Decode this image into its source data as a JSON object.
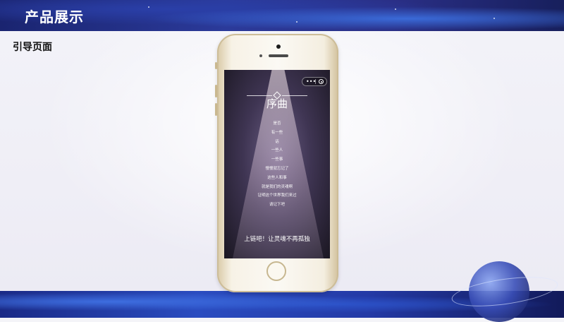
{
  "header": {
    "title": "产品展示"
  },
  "section": {
    "label": "引导页面"
  },
  "phone_screen": {
    "title": "序曲",
    "poem_lines": [
      "是否",
      "有一些",
      "话",
      "一些人",
      "一些事",
      "慢慢就忘记了",
      "这些人和事",
      "就是我们的灵魂啊",
      "证明这个世界我们来过",
      "请记下吧"
    ],
    "slogan": "上链吧！让灵魂不再孤独",
    "menu_dots": "•••"
  },
  "icons": [
    "more-icon",
    "close-capsule-icon",
    "ornament-diamond-icon",
    "home-button-icon",
    "planet-decoration"
  ],
  "colors": {
    "header_bg": "#2b3a9a",
    "screen_bg": "#3f3553"
  }
}
